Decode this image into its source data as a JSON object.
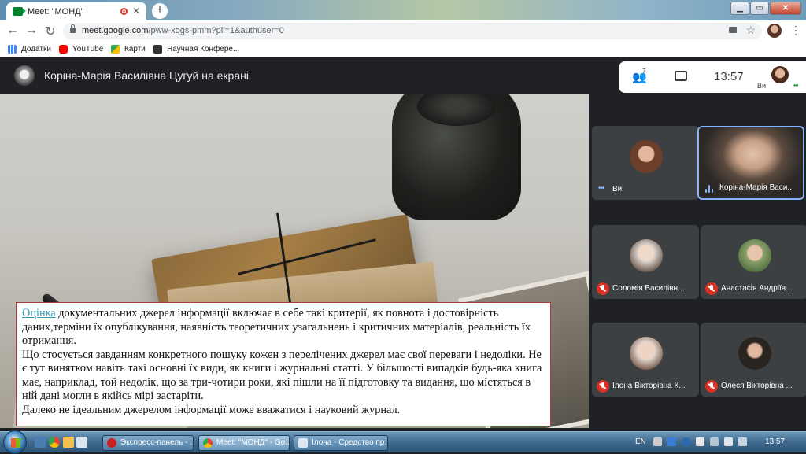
{
  "browser": {
    "tab_title": "Meet: \"МОНД\"",
    "tab_close": "✕",
    "new_tab": "+",
    "url_host": "meet.google.com",
    "url_path": "/pww-xogs-pmm?pli=1&authuser=0",
    "window_controls": {
      "minimize": "▁",
      "maximize": "▭",
      "close": "✕"
    },
    "bookmarks": [
      {
        "label": "Додатки",
        "icon": "apps-grid-icon",
        "color": "#4285f4"
      },
      {
        "label": "YouTube",
        "icon": "youtube-icon",
        "color": "#ff0000"
      },
      {
        "label": "Карти",
        "icon": "maps-icon",
        "color": "#34a853"
      },
      {
        "label": "Научная Конфере...",
        "icon": "bookmark-site-icon",
        "color": "#333333"
      }
    ]
  },
  "meet": {
    "presenter_banner": "Коріна-Марія Василівна Цугуй на екрані",
    "participants_count": "7",
    "clock": "13:57",
    "self_label": "Ви",
    "participants": [
      {
        "name": "Ви",
        "muted": false,
        "indicator": "dots",
        "avatar_color": "#6b3f2a"
      },
      {
        "name": "Коріна-Марія Васи...",
        "muted": false,
        "indicator": "speaking",
        "video": true
      },
      {
        "name": "Соломія Василівн...",
        "muted": true,
        "avatar_color": "#d9d1cb"
      },
      {
        "name": "Анастасія Андріїв...",
        "muted": true,
        "avatar_color": "#8aa06a"
      },
      {
        "name": "Ілона Вікторівна К...",
        "muted": true,
        "avatar_color": "#e4d7cf"
      },
      {
        "name": "Олеся Вікторівна ...",
        "muted": true,
        "avatar_color": "#2a2421"
      }
    ]
  },
  "slide": {
    "link_word": "Оцінка",
    "line1_rest": " документальних джерел інформації включає в себе такі критерії, як повнота і достовірність даних,терміни їх опублікування, наявність теоретичних узагальнень і критичних матеріалів, реальність їх отримання.",
    "para2": "Що стосується завданням конкретного пошуку кожен з перелічених джерел має свої переваги і недоліки. Не є тут винятком навіть такі основні їх види, як книги і журнальні статті. У більшості випадків будь-яка книга має, наприклад, той недолік, що за три-чотири роки, які пішли на її підготовку та видання, що містяться в ній дані могли в якійсь мірі застаріти.",
    "para3": "Далеко не ідеальним джерелом інформації може вважатися і науковий журнал."
  },
  "taskbar": {
    "items": [
      {
        "label": "Экспресс-панель - ...",
        "icon_color": "#cc1f1f",
        "active": false
      },
      {
        "label": "Meet: \"МОНД\" - Go...",
        "icon_color": "#4285f4",
        "active": true
      },
      {
        "label": "Ілона - Средство пр...",
        "icon_color": "#e0e6ee",
        "active": false
      }
    ],
    "lang": "EN",
    "clock": "13:57"
  }
}
